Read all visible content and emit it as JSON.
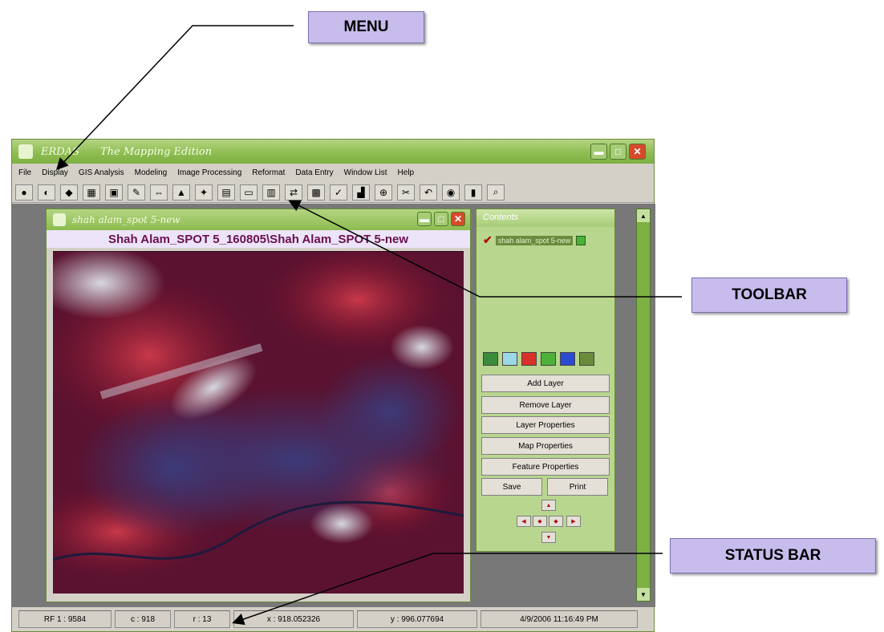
{
  "callouts": {
    "menu": "MENU",
    "toolbar": "TOOLBAR",
    "status_bar": "STATUS BAR"
  },
  "app": {
    "title_left": "ERDAS",
    "title_right": "The Mapping Edition"
  },
  "menu": [
    "File",
    "Display",
    "GIS Analysis",
    "Modeling",
    "Image Processing",
    "Reformat",
    "Data Entry",
    "Window List",
    "Help"
  ],
  "toolbar_icons": [
    "globe-icon",
    "open-folder-icon",
    "leaf-icon",
    "grid-icon",
    "layers-icon",
    "vector-icon",
    "swap-icon",
    "tank-icon",
    "move-icon",
    "viewer-icon",
    "rectangle-icon",
    "map-icon",
    "link-icon",
    "table-icon",
    "query-icon",
    "chart-icon",
    "target-icon",
    "scissors-icon",
    "undo-icon",
    "eye-icon",
    "bar-chart-icon",
    "search-icon"
  ],
  "viewer": {
    "title": "shah alam_spot 5-new",
    "caption": "Shah Alam_SPOT 5_160805\\Shah Alam_SPOT 5-new"
  },
  "contents": {
    "title": "Contents",
    "layer": "shah alam_spot 5-new",
    "colors": [
      "#3a8c3a",
      "#9ed8e6",
      "#d8322a",
      "#4cb03a",
      "#2a4cd0",
      "#6a8c3c"
    ],
    "buttons": {
      "add": "Add Layer",
      "remove": "Remove Layer",
      "layer_props": "Layer Properties",
      "map_props": "Map Properties",
      "feature_props": "Feature Properties",
      "save": "Save",
      "print": "Print"
    }
  },
  "status": {
    "rf": "RF 1 : 9584",
    "c": "c : 918",
    "r": "r : 13",
    "x": "x : 918.052326",
    "y": "y : 996.077694",
    "datetime": "4/9/2006 11:16:49 PM"
  }
}
